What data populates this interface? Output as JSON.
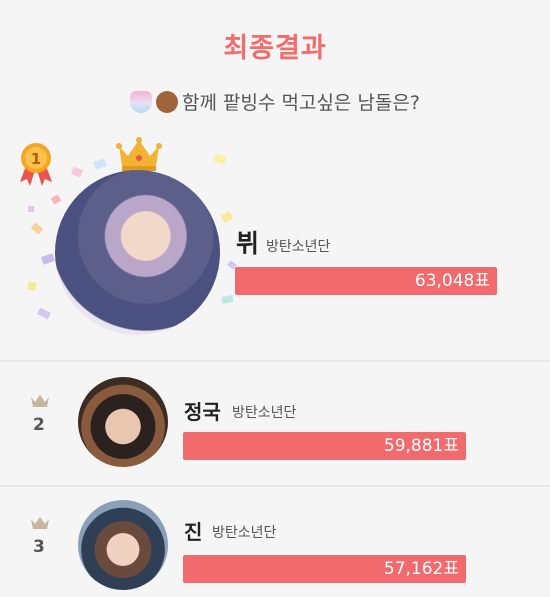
{
  "header": {
    "title": "최종결과",
    "subtitle": "함께 팥빙수 먹고싶은 남돌은?",
    "icons": [
      "shaved-ice-icon",
      "person-face-icon"
    ]
  },
  "results": [
    {
      "rank": "1",
      "name": "뷔",
      "group": "방탄소년단",
      "votes": "63,048표",
      "share": 1.0
    },
    {
      "rank": "2",
      "name": "정국",
      "group": "방탄소년단",
      "votes": "59,881표",
      "share": 0.95
    },
    {
      "rank": "3",
      "name": "진",
      "group": "방탄소년단",
      "votes": "57,162표",
      "share": 0.907
    }
  ],
  "colors": {
    "accent": "#f36b6b",
    "bar": "#f16a6d",
    "medal": "#f6a623",
    "medal_ribbon": "#e9544f",
    "crown": "#f2b234",
    "background": "#f5f5f5"
  }
}
